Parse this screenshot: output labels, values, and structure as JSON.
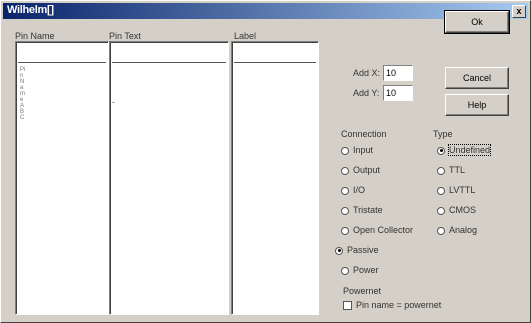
{
  "window": {
    "title": "Wilhelm[]",
    "close_label": "x"
  },
  "columns": {
    "pin_name": "Pin Name",
    "pin_text": "Pin Text",
    "label": "Label"
  },
  "pin_name_list_text": "Pin Name A B C",
  "pin_text_marker": "-",
  "fields": {
    "add_x_label": "Add X:",
    "add_x_value": "10",
    "add_y_label": "Add Y:",
    "add_y_value": "10"
  },
  "buttons": {
    "ok": "Ok",
    "cancel": "Cancel",
    "help": "Help"
  },
  "connection": {
    "label": "Connection",
    "options": [
      "Input",
      "Output",
      "I/O",
      "Tristate",
      "Open Collector",
      "Passive",
      "Power"
    ],
    "selected": "Passive"
  },
  "type": {
    "label": "Type",
    "options": [
      "Undefined",
      "TTL",
      "LVTTL",
      "CMOS",
      "Analog"
    ],
    "selected": "Undefined"
  },
  "powernet": {
    "label": "Powernet",
    "checkbox_label": "Pin name = powernet"
  }
}
